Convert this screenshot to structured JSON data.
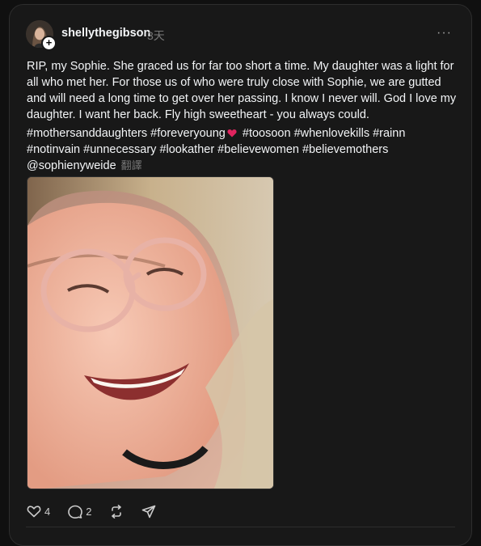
{
  "post": {
    "username": "shellythegibson",
    "timestamp": "3天",
    "more_label": "···",
    "text": "RIP, my Sophie. She graced us for far too short a time. My daughter was a light for all who met her. For those us of who were truly close with Sophie, we are gutted and will need a long time to get over her passing. I know I never will. God I love my daughter. I want her back. Fly high sweetheart - you always could.",
    "tags_before_heart": "#mothersanddaughters #foreveryoung",
    "tags_after_heart": " #toosoon #whenlovekills #rainn #notinvain #unnecessary #lookather #believewomen #believemothers @sophienyweide",
    "translate_label": "翻譯",
    "image": "smiling-girl-with-glasses-photo"
  },
  "actions": {
    "like_count": "4",
    "reply_count": "2",
    "like_icon": "heart-icon",
    "reply_icon": "comment-icon",
    "repost_icon": "repost-icon",
    "share_icon": "send-icon"
  },
  "colors": {
    "background": "#101010",
    "card": "#181818",
    "text": "#f3f5f7",
    "muted": "#777777",
    "heart_emoji": "#e0245e"
  }
}
